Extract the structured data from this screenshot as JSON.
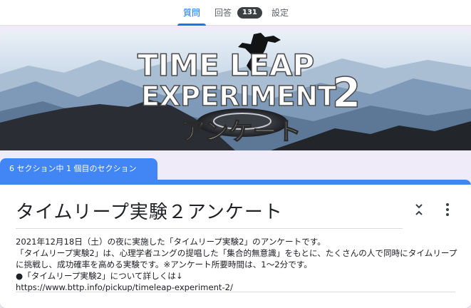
{
  "tabs": {
    "questions": "質問",
    "answers": "回答",
    "answers_count": "131",
    "settings": "設定"
  },
  "banner": {
    "line1": "TIME LEAP",
    "line2": "EXPERIMENT",
    "number": "2",
    "subtitle": "アンケート"
  },
  "section": {
    "label": "6 セクション中 1 個目のセクション"
  },
  "form": {
    "title": "タイムリープ実験２アンケート",
    "description": [
      "2021年12月18日（土）の夜に実施した「タイムリープ実験2」のアンケートです。",
      "「タイムリープ実験2」は、心理学者ユングの提唱した「集合的無意識」をもとに、たくさんの人で同時にタイムリープに挑戦し、成功確率を高める実験です。※アンケート所要時間は、1〜2分です。",
      "●「タイムリープ実験2」について詳しくは↓",
      "https://www.bttp.info/pickup/timeleap-experiment-2/"
    ]
  },
  "colors": {
    "accent": "#4285f4",
    "tab_active": "#1a73e8",
    "background": "#f0ebf8"
  },
  "icons": {
    "collapse": "collapse-icon",
    "menu": "more-vert-icon"
  }
}
